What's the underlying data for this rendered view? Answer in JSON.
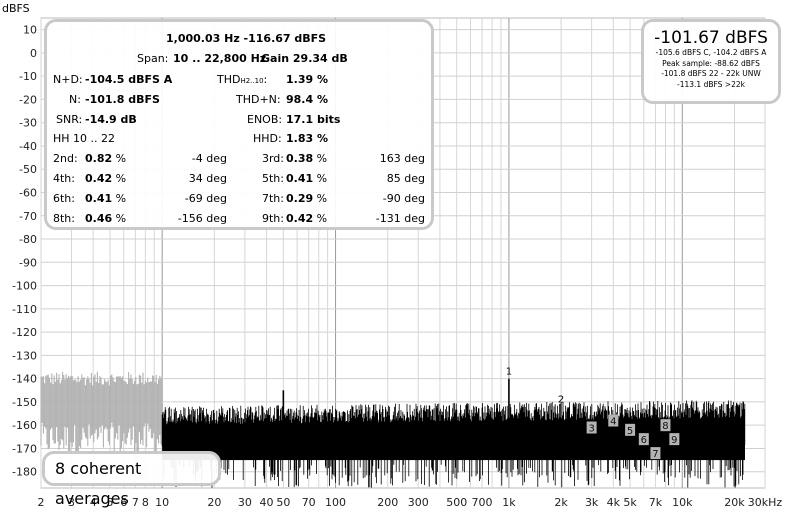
{
  "chart_data": {
    "type": "line",
    "title": "",
    "xlabel": "kHz",
    "ylabel": "dBFS",
    "x_scale": "log",
    "xlim": [
      2,
      30000
    ],
    "ylim": [
      -187,
      15
    ],
    "grid": true,
    "y_ticks": [
      10,
      0,
      -10,
      -20,
      -30,
      -40,
      -50,
      -60,
      -70,
      -80,
      -90,
      -100,
      -110,
      -120,
      -130,
      -140,
      -150,
      -160,
      -170,
      -180
    ],
    "x_ticks": [
      {
        "v": 2,
        "label": "2"
      },
      {
        "v": 3,
        "label": "3"
      },
      {
        "v": 4,
        "label": "4"
      },
      {
        "v": 5,
        "label": "5"
      },
      {
        "v": 6,
        "label": "6"
      },
      {
        "v": 7,
        "label": "7"
      },
      {
        "v": 8,
        "label": "8"
      },
      {
        "v": 10,
        "label": "10"
      },
      {
        "v": 20,
        "label": "20"
      },
      {
        "v": 30,
        "label": "30"
      },
      {
        "v": 40,
        "label": "40"
      },
      {
        "v": 50,
        "label": "50"
      },
      {
        "v": 70,
        "label": "70"
      },
      {
        "v": 100,
        "label": "100"
      },
      {
        "v": 200,
        "label": "200"
      },
      {
        "v": 300,
        "label": "300"
      },
      {
        "v": 500,
        "label": "500"
      },
      {
        "v": 700,
        "label": "700"
      },
      {
        "v": 1000,
        "label": "1k"
      },
      {
        "v": 2000,
        "label": "2k"
      },
      {
        "v": 3000,
        "label": "3k"
      },
      {
        "v": 4000,
        "label": "4k"
      },
      {
        "v": 5000,
        "label": "5k"
      },
      {
        "v": 7000,
        "label": "7k"
      },
      {
        "v": 10000,
        "label": "10k"
      },
      {
        "v": 20000,
        "label": "20k"
      },
      {
        "v": 30000,
        "label": "30kHz"
      }
    ],
    "series": [
      {
        "color": "#b0b0b0",
        "x": [
          2,
          10
        ],
        "noise_floor_range": [
          -173,
          -143
        ]
      },
      {
        "color": "#000000",
        "x": [
          10,
          23000
        ],
        "noise_floor_range": [
          -187,
          -152
        ]
      }
    ],
    "peaks": [
      {
        "x": 50,
        "y": -145
      },
      {
        "x": 1000,
        "y": -140
      }
    ],
    "harmonic_markers": [
      {
        "label": "1",
        "x": 1000,
        "y": -140
      },
      {
        "label": "2",
        "x": 2000,
        "y": -152
      },
      {
        "label": "3",
        "x": 3000,
        "y": -161
      },
      {
        "label": "4",
        "x": 4000,
        "y": -158
      },
      {
        "label": "5",
        "x": 5000,
        "y": -162
      },
      {
        "label": "6",
        "x": 6000,
        "y": -166
      },
      {
        "label": "7",
        "x": 7000,
        "y": -172
      },
      {
        "label": "8",
        "x": 8000,
        "y": -160
      },
      {
        "label": "9",
        "x": 9000,
        "y": -166
      }
    ]
  },
  "stats": {
    "header": "1,000.03 Hz  -116.67 dBFS",
    "span_label": "Span:",
    "span_value": "10 .. 22,800 Hz",
    "gain_value": "Gain 29.34 dB",
    "nd_label": "N+D:",
    "nd_value": "-104.5 dBFS A",
    "thd_label": "THD",
    "thd_sub": "H2..10",
    "thd_colon": ":",
    "thd_value": "1.39 %",
    "n_label": "N:",
    "n_value": "-101.8 dBFS",
    "thdn_label": "THD+N:",
    "thdn_value": "98.4 %",
    "snr_label": "SNR:",
    "snr_value": "-14.9 dB",
    "enob_label": "ENOB:",
    "enob_value": "17.1 bits",
    "hh_label": "HH 10 .. 22",
    "hhd_label": "HHD:",
    "hhd_value": "1.83 %",
    "harmonics": [
      {
        "l1": "2nd:",
        "v1": "0.82",
        "d1": "-4 deg",
        "l2": "3rd:",
        "v2": "0.38",
        "d2": "163 deg"
      },
      {
        "l1": "4th:",
        "v1": "0.42",
        "d1": "34 deg",
        "l2": "5th:",
        "v2": "0.41",
        "d2": "85 deg"
      },
      {
        "l1": "6th:",
        "v1": "0.41",
        "d1": "-69 deg",
        "l2": "7th:",
        "v2": "0.29",
        "d2": "-90 deg"
      },
      {
        "l1": "8th:",
        "v1": "0.46",
        "d1": "-156 deg",
        "l2": "9th:",
        "v2": "0.42",
        "d2": "-131 deg"
      }
    ],
    "pct": "%"
  },
  "peak_box": {
    "value": "-101.67 dBFS",
    "lines": [
      "-105.6 dBFS C, -104.2 dBFS A",
      "Peak sample: -88.62 dBFS",
      "-101.8 dBFS 22 - 22k UNW",
      "-113.1 dBFS >22k"
    ]
  },
  "averages_label": "8 coherent averages"
}
